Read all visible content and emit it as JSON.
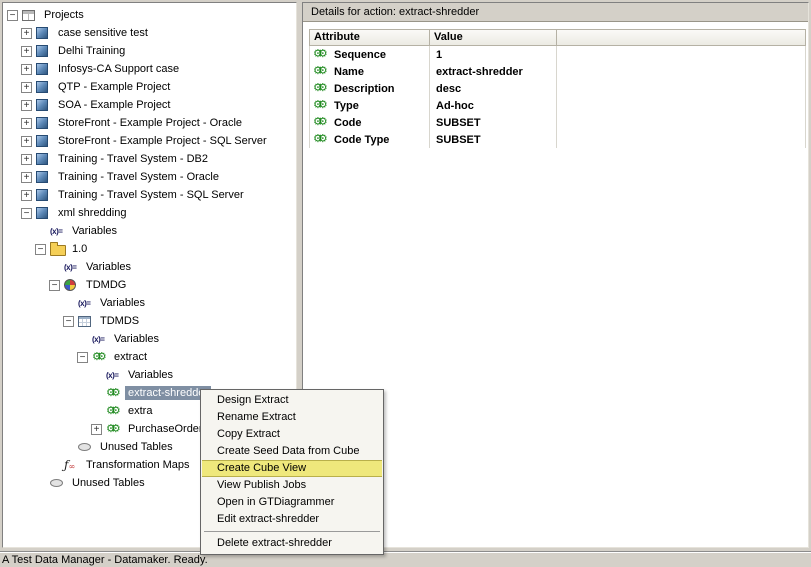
{
  "colors": {
    "window_bg": "#d4d0c8",
    "selection_bg": "#7f8fa3",
    "menu_highlight": "#efe87c",
    "gear_green": "#1f8a1f"
  },
  "tree": {
    "items": [
      {
        "level": 0,
        "expander": "-",
        "icon": "grid",
        "label": "Projects"
      },
      {
        "level": 1,
        "expander": "+",
        "icon": "cube",
        "label": "case sensitive test"
      },
      {
        "level": 1,
        "expander": "+",
        "icon": "cube",
        "label": "Delhi Training"
      },
      {
        "level": 1,
        "expander": "+",
        "icon": "cube",
        "label": "Infosys-CA Support case"
      },
      {
        "level": 1,
        "expander": "+",
        "icon": "cube",
        "label": "QTP - Example Project"
      },
      {
        "level": 1,
        "expander": "+",
        "icon": "cube",
        "label": "SOA - Example Project"
      },
      {
        "level": 1,
        "expander": "+",
        "icon": "cube",
        "label": "StoreFront - Example Project - Oracle"
      },
      {
        "level": 1,
        "expander": "+",
        "icon": "cube",
        "label": "StoreFront - Example Project - SQL Server"
      },
      {
        "level": 1,
        "expander": "+",
        "icon": "cube",
        "label": "Training - Travel System - DB2"
      },
      {
        "level": 1,
        "expander": "+",
        "icon": "cube",
        "label": "Training - Travel System - Oracle"
      },
      {
        "level": 1,
        "expander": "+",
        "icon": "cube",
        "label": "Training - Travel System - SQL Server"
      },
      {
        "level": 1,
        "expander": "-",
        "icon": "cube",
        "label": "xml shredding"
      },
      {
        "level": 2,
        "expander": "",
        "icon": "varsign",
        "label": "Variables"
      },
      {
        "level": 2,
        "expander": "-",
        "icon": "folder",
        "label": "1.0"
      },
      {
        "level": 3,
        "expander": "",
        "icon": "varsign",
        "label": "Variables"
      },
      {
        "level": 3,
        "expander": "-",
        "icon": "pie",
        "label": "TDMDG"
      },
      {
        "level": 4,
        "expander": "",
        "icon": "varsign",
        "label": "Variables"
      },
      {
        "level": 4,
        "expander": "-",
        "icon": "table",
        "label": "TDMDS"
      },
      {
        "level": 5,
        "expander": "",
        "icon": "varsign",
        "label": "Variables"
      },
      {
        "level": 5,
        "expander": "-",
        "icon": "gears",
        "label": "extract"
      },
      {
        "level": 6,
        "expander": "",
        "icon": "varsign",
        "label": "Variables"
      },
      {
        "level": 6,
        "expander": "",
        "icon": "gears",
        "label": "extract-shredder",
        "selected": true
      },
      {
        "level": 6,
        "expander": "",
        "icon": "gears",
        "label": "extra"
      },
      {
        "level": 6,
        "expander": "+",
        "icon": "gears",
        "label": "PurchaseOrder"
      },
      {
        "level": 4,
        "expander": "",
        "icon": "ellipse",
        "label": "Unused Tables"
      },
      {
        "level": 3,
        "expander": "",
        "icon": "fx",
        "label": "Transformation Maps"
      },
      {
        "level": 2,
        "expander": "",
        "icon": "ellipse",
        "label": "Unused Tables"
      }
    ]
  },
  "details": {
    "title": "Details for action: extract-shredder",
    "columns": [
      "Attribute",
      "Value",
      ""
    ],
    "rows": [
      {
        "attribute": "Sequence",
        "value": "1"
      },
      {
        "attribute": "Name",
        "value": "extract-shredder"
      },
      {
        "attribute": "Description",
        "value": "desc"
      },
      {
        "attribute": "Type",
        "value": "Ad-hoc"
      },
      {
        "attribute": "Code",
        "value": "SUBSET"
      },
      {
        "attribute": "Code Type",
        "value": "SUBSET"
      }
    ]
  },
  "context_menu": {
    "items": [
      {
        "label": "Design Extract"
      },
      {
        "label": "Rename Extract"
      },
      {
        "label": "Copy Extract"
      },
      {
        "label": "Create Seed Data from Cube"
      },
      {
        "label": "Create Cube View",
        "highlighted": true
      },
      {
        "label": "View Publish Jobs"
      },
      {
        "label": "Open in GTDiagrammer"
      },
      {
        "label": "Edit extract-shredder"
      },
      {
        "separator": true
      },
      {
        "label": "Delete extract-shredder"
      }
    ]
  },
  "status_bar": {
    "text": "A Test Data Manager - Datamaker. Ready."
  }
}
